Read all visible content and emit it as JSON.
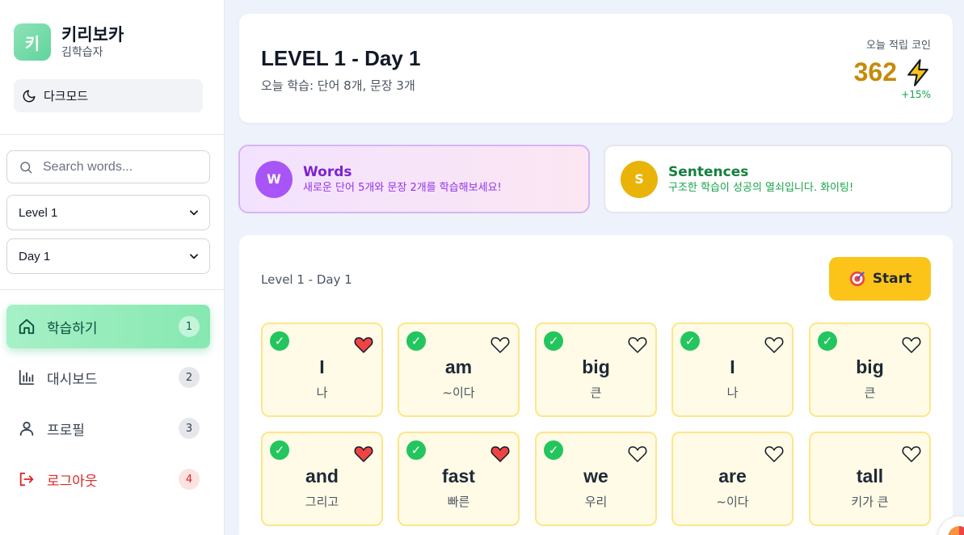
{
  "brand": {
    "logo_char": "키",
    "title": "키리보카",
    "subtitle": "김학습자"
  },
  "dark_mode": {
    "label": "다크모드"
  },
  "search": {
    "placeholder": "Search words..."
  },
  "filters": {
    "level": "Level 1",
    "day": "Day 1"
  },
  "nav": [
    {
      "label": "학습하기",
      "badge": "1",
      "icon": "home-icon"
    },
    {
      "label": "대시보드",
      "badge": "2",
      "icon": "bar-chart-icon"
    },
    {
      "label": "프로필",
      "badge": "3",
      "icon": "user-icon"
    },
    {
      "label": "로그아웃",
      "badge": "4",
      "icon": "logout-icon"
    }
  ],
  "header": {
    "title": "LEVEL 1 - Day 1",
    "subtitle": "오늘 학습: 단어 8개, 문장 3개",
    "coin_label": "오늘 적립 코인",
    "coin_value": "362",
    "coin_change": "+15%"
  },
  "info_cards": {
    "words": {
      "circle": "W",
      "title": "Words",
      "desc": "새로운 단어 5개와 문장 2개를 학습해보세요!",
      "accent": "#a855f7"
    },
    "sentences": {
      "circle": "S",
      "title": "Sentences",
      "desc": "구조한 학습이 성공의 열쇠입니다. 화이팅!",
      "accent": "#eab308"
    }
  },
  "words_section": {
    "label": "Level 1 - Day 1",
    "start_label": "Start",
    "words": [
      {
        "en": "I",
        "ko": "나",
        "checked": true,
        "liked": true
      },
      {
        "en": "am",
        "ko": "~이다",
        "checked": true,
        "liked": false
      },
      {
        "en": "big",
        "ko": "큰",
        "checked": true,
        "liked": false
      },
      {
        "en": "I",
        "ko": "나",
        "checked": true,
        "liked": false
      },
      {
        "en": "big",
        "ko": "큰",
        "checked": true,
        "liked": false
      },
      {
        "en": "and",
        "ko": "그리고",
        "checked": true,
        "liked": true
      },
      {
        "en": "fast",
        "ko": "빠른",
        "checked": true,
        "liked": true
      },
      {
        "en": "we",
        "ko": "우리",
        "checked": true,
        "liked": false
      },
      {
        "en": "are",
        "ko": "~이다",
        "checked": false,
        "liked": false
      },
      {
        "en": "tall",
        "ko": "키가 큰",
        "checked": false,
        "liked": false
      }
    ]
  },
  "colors": {
    "accent_green": "#22c55e",
    "coin_gold": "#c58b0a",
    "start_yellow": "#fcc419",
    "logout_red": "#dc2626"
  }
}
